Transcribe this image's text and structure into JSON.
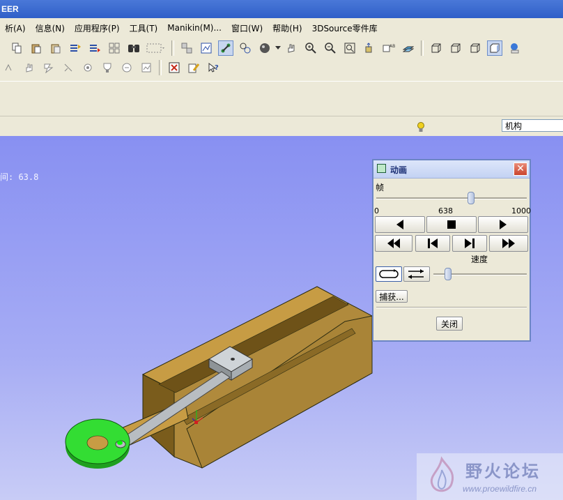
{
  "window": {
    "title": "EER"
  },
  "menu": [
    "析(A)",
    "信息(N)",
    "应用程序(P)",
    "工具(T)",
    "Manikin(M)...",
    "窗口(W)",
    "帮助(H)",
    "3DSource零件库"
  ],
  "toolbar": {
    "row1_icons": [
      "copy-icon",
      "paste-icon",
      "paste-special-icon",
      "regenerate-icon",
      "regen-manager-icon",
      "find-icon",
      "search-icon",
      "selection-box-icon",
      "layers-icon",
      "display-style-icon",
      "mechanism-icon",
      "connection-icon",
      "sphere-icon",
      "pan-icon",
      "zoom-in-icon",
      "zoom-out-icon",
      "refit-icon",
      "orient-icon",
      "saved-views-icon",
      "datum-display-icon",
      "wireframe-icon",
      "hidden-line-icon",
      "no-hidden-icon",
      "shading-icon",
      "appearance-icon"
    ],
    "row2_icons": [
      "drag-icon",
      "hand-icon",
      "servo-icon",
      "pin-icon",
      "gear-icon",
      "trophy-icon",
      "motor-icon",
      "analysis-icon",
      "close-window-icon",
      "edit-icon",
      "whats-this-icon"
    ]
  },
  "status": {
    "mechanism_select": "机构"
  },
  "viewport": {
    "time_label": "间: 63.8"
  },
  "animation_dialog": {
    "title": "动画",
    "frame_label": "帧",
    "slider_min": "0",
    "slider_value": "638",
    "slider_max": "1000",
    "frame_fraction": 0.638,
    "speed_label": "速度",
    "speed_fraction": 0.13,
    "capture_button": "捕获...",
    "close_button": "关闭",
    "playback_buttons": [
      "play-reverse-icon",
      "stop-icon",
      "play-forward-icon"
    ],
    "step_buttons": [
      "rewind-icon",
      "step-back-icon",
      "step-forward-icon",
      "fast-forward-icon"
    ],
    "loop_buttons": [
      "repeat-icon",
      "reverse-repeat-icon"
    ]
  },
  "watermark": {
    "text": "野火论坛",
    "url": "www.proewildfire.cn"
  },
  "colors": {
    "viewport_bg": "#8d95f0",
    "part_tan": "#c79c44",
    "crank_green": "#33dd33",
    "link_gray": "#b8bdc2"
  }
}
